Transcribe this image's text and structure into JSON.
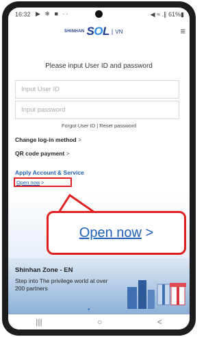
{
  "status_bar": {
    "time": "16:32",
    "left_icons": "▶ ❄ ■ ··",
    "right_text": "◀ ≈ .∥ 61%▮"
  },
  "header": {
    "brand": "SHINHAN",
    "logo_text_main": "S",
    "logo_text_o": "O",
    "logo_text_end": "L",
    "separator": "|",
    "country": "VN",
    "menu_icon": "hamburger-menu-icon"
  },
  "login": {
    "title": "Please input User ID and password",
    "user_id_placeholder": "Input User ID",
    "password_placeholder": "Input password",
    "forgot_label": "Forgot User ID",
    "divider": "|",
    "reset_label": "Reset password"
  },
  "menu": {
    "change_login": "Change log-in method",
    "qr_payment": "QR code payment",
    "arrow": ">"
  },
  "apply": {
    "title": "Apply Account & Service",
    "open_now": "Open now",
    "arrow": ">"
  },
  "callout": {
    "label": "Open now",
    "arrow": ">"
  },
  "zone": {
    "title": "Shinhan Zone - EN",
    "description": "Step into The privilege world at over 200 partners"
  },
  "carousel": {
    "dots": "●●●●",
    "active_dot": "●"
  },
  "navbar": {
    "recent": "|||",
    "home": "○",
    "back": "<"
  },
  "colors": {
    "accent": "#1f5fb5",
    "highlight": "#e02020"
  }
}
